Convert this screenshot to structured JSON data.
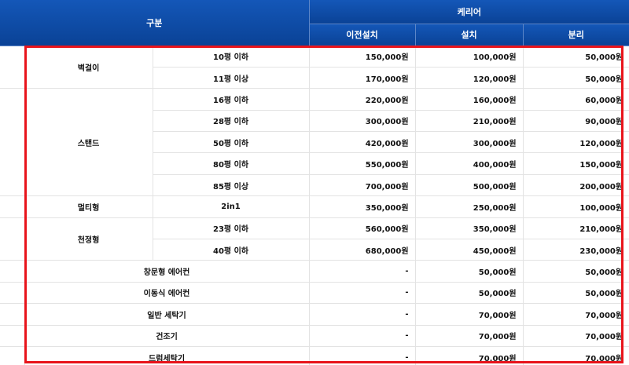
{
  "header": {
    "category_label": "구분",
    "group_label": "케리어",
    "columns": [
      "이전설치",
      "설치",
      "분리"
    ]
  },
  "groups": [
    {
      "category": "벽걸이",
      "rows": [
        {
          "sub": "10평 이하",
          "values": [
            "150,000원",
            "100,000원",
            "50,000원"
          ]
        },
        {
          "sub": "11평 이상",
          "values": [
            "170,000원",
            "120,000원",
            "50,000원"
          ]
        }
      ]
    },
    {
      "category": "스탠드",
      "rows": [
        {
          "sub": "16평 이하",
          "values": [
            "220,000원",
            "160,000원",
            "60,000원"
          ]
        },
        {
          "sub": "28평 이하",
          "values": [
            "300,000원",
            "210,000원",
            "90,000원"
          ]
        },
        {
          "sub": "50평 이하",
          "values": [
            "420,000원",
            "300,000원",
            "120,000원"
          ]
        },
        {
          "sub": "80평 이하",
          "values": [
            "550,000원",
            "400,000원",
            "150,000원"
          ]
        },
        {
          "sub": "85평 이상",
          "values": [
            "700,000원",
            "500,000원",
            "200,000원"
          ]
        }
      ]
    },
    {
      "category": "멀티형",
      "rows": [
        {
          "sub": "2in1",
          "values": [
            "350,000원",
            "250,000원",
            "100,000원"
          ]
        }
      ]
    },
    {
      "category": "천정형",
      "rows": [
        {
          "sub": "23평 이하",
          "values": [
            "560,000원",
            "350,000원",
            "210,000원"
          ]
        },
        {
          "sub": "40평 이하",
          "values": [
            "680,000원",
            "450,000원",
            "230,000원"
          ]
        }
      ]
    }
  ],
  "single_rows": [
    {
      "category": "창문형 에어컨",
      "values": [
        "-",
        "50,000원",
        "50,000원"
      ]
    },
    {
      "category": "이동식 에어컨",
      "values": [
        "-",
        "50,000원",
        "50,000원"
      ]
    },
    {
      "category": "일반 세탁기",
      "values": [
        "-",
        "70,000원",
        "70,000원"
      ]
    },
    {
      "category": "건조기",
      "values": [
        "-",
        "70,000원",
        "70,000원"
      ]
    },
    {
      "category": "드럼세탁기",
      "values": [
        "-",
        "70,000원",
        "70,000원"
      ]
    }
  ],
  "colors": {
    "header_bg": "#0c4aa6",
    "highlight_border": "#e8141b"
  }
}
